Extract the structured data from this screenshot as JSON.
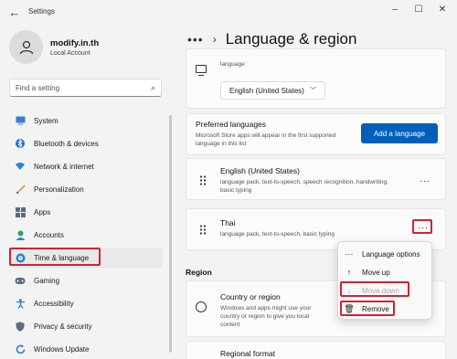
{
  "app": {
    "title": "Settings"
  },
  "profile": {
    "name": "modify.in.th",
    "subtitle": "Local Account"
  },
  "search": {
    "placeholder": "Find a setting"
  },
  "nav": {
    "items": [
      {
        "label": "System",
        "icon": "monitor-icon"
      },
      {
        "label": "Bluetooth & devices",
        "icon": "bluetooth-icon"
      },
      {
        "label": "Network & internet",
        "icon": "wifi-icon"
      },
      {
        "label": "Personalization",
        "icon": "brush-icon"
      },
      {
        "label": "Apps",
        "icon": "apps-icon"
      },
      {
        "label": "Accounts",
        "icon": "person-icon"
      },
      {
        "label": "Time & language",
        "icon": "globe-clock-icon",
        "selected": true
      },
      {
        "label": "Gaming",
        "icon": "gamepad-icon"
      },
      {
        "label": "Accessibility",
        "icon": "accessibility-icon"
      },
      {
        "label": "Privacy & security",
        "icon": "shield-icon"
      },
      {
        "label": "Windows Update",
        "icon": "update-icon"
      }
    ]
  },
  "header": {
    "more": "•••",
    "separator": "›",
    "title": "Language & region"
  },
  "windows_display": {
    "label": "language",
    "value": "English (United States)"
  },
  "preferred": {
    "title": "Preferred languages",
    "subtitle": "Microsoft Store apps will appear in the first supported language in this list",
    "add_button": "Add a language"
  },
  "languages": [
    {
      "name": "English (United States)",
      "desc": "language pack, text-to-speech, speech recognition, handwriting, basic typing",
      "more": "···"
    },
    {
      "name": "Thai",
      "desc": "language pack, text-to-speech, basic typing",
      "more": "···"
    }
  ],
  "region": {
    "section": "Region",
    "country_title": "Country or region",
    "country_desc": "Windows and apps might use your country or region to give you local content",
    "regional_format": "Regional format"
  },
  "context_menu": {
    "items": [
      {
        "label": "Language options",
        "icon": "more-icon",
        "enabled": true
      },
      {
        "label": "Move up",
        "icon": "arrow-up-icon",
        "enabled": true
      },
      {
        "label": "Move down",
        "icon": "arrow-down-icon",
        "enabled": false
      },
      {
        "label": "Remove",
        "icon": "trash-icon",
        "enabled": true
      }
    ]
  },
  "colors": {
    "accent": "#005fb8",
    "highlight": "#d6202f",
    "background": "#f3f3f3"
  }
}
